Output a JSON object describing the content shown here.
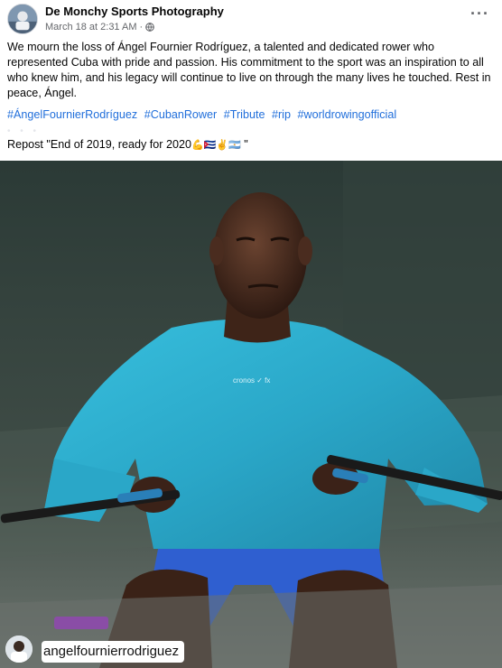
{
  "post": {
    "author": "De Monchy Sports Photography",
    "timestamp": "March 18 at 2:31 AM",
    "separator": "·",
    "privacy_icon": "globe-icon",
    "more_icon": "more-options-icon",
    "more_label": "···",
    "body": "We mourn the loss of Ángel Fournier Rodríguez, a talented and dedicated rower who represented Cuba with pride and passion. His commitment to the sport was an inspiration to all who knew him, and his legacy will continue to live on through the many lives he touched. Rest in peace, Ángel.",
    "hashtags": [
      "#ÁngelFournierRodríguez",
      "#CubanRower",
      "#Tribute",
      "#rip",
      "#worldrowingofficial"
    ],
    "repost_prefix": "Repost \"End of 2019, ready for 2020",
    "repost_emojis": "💪🇨🇺✌️🇦🇷",
    "repost_suffix": " \""
  },
  "image": {
    "shirt_text": "cronos ✓ fx",
    "overlay_handle": "angelfournierrodriguez"
  },
  "colors": {
    "hashtag": "#216fdb",
    "meta": "#65676b",
    "shirt": "#2aa7c8",
    "shorts": "#2f5fd0"
  }
}
